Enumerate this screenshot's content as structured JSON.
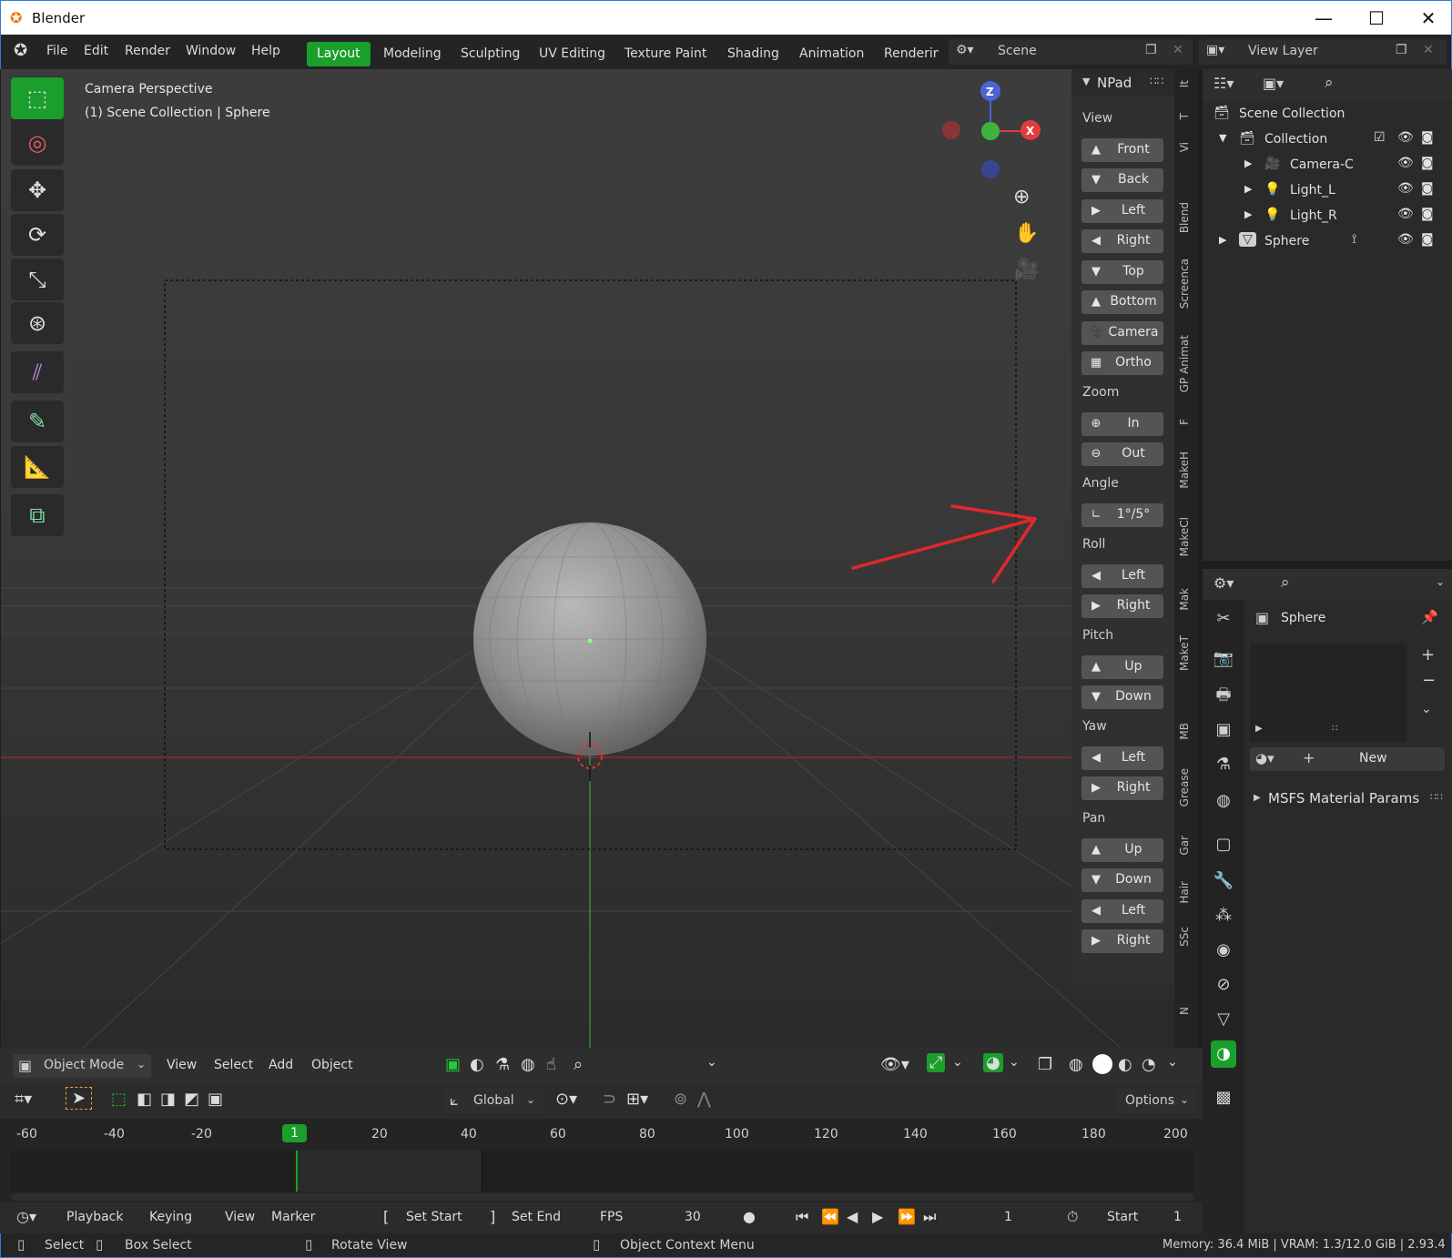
{
  "window": {
    "title": "Blender",
    "minimize": "—",
    "maximize": "☐",
    "close": "✕"
  },
  "menu": {
    "items": [
      "File",
      "Edit",
      "Render",
      "Window",
      "Help"
    ]
  },
  "workspaces": [
    "Layout",
    "Modeling",
    "Sculpting",
    "UV Editing",
    "Texture Paint",
    "Shading",
    "Animation",
    "Renderin"
  ],
  "scene": {
    "label": "Scene"
  },
  "viewlayer": {
    "label": "View Layer"
  },
  "viewport": {
    "perspective": "Camera Perspective",
    "collection": "(1) Scene Collection | Sphere"
  },
  "gizmo": {
    "z": "Z",
    "x": "X"
  },
  "npad": {
    "title": "NPad",
    "sections": {
      "view": "View",
      "zoom": "Zoom",
      "angle": "Angle",
      "roll": "Roll",
      "pitch": "Pitch",
      "yaw": "Yaw",
      "pan": "Pan"
    },
    "view_buttons": [
      "Front",
      "Back",
      "Left",
      "Right",
      "Top",
      "Bottom",
      "Camera",
      "Ortho"
    ],
    "zoom_buttons": [
      "In",
      "Out"
    ],
    "angle_value": "1°/5°",
    "roll_buttons": [
      "Left",
      "Right"
    ],
    "pitch_buttons": [
      "Up",
      "Down"
    ],
    "yaw_buttons": [
      "Left",
      "Right"
    ],
    "pan_buttons": [
      "Up",
      "Down",
      "Left",
      "Right"
    ]
  },
  "sidetabs": [
    "It",
    "T",
    "Vi",
    "Blend",
    "Screenca",
    "GP Animat",
    "F",
    "MakeH",
    "MakeCl",
    "Mak",
    "MakeT",
    "MB",
    "Grease",
    "Gar",
    "Hair",
    "SSc",
    "N"
  ],
  "outliner": {
    "rows": [
      {
        "label": "Scene Collection"
      },
      {
        "label": "Collection"
      },
      {
        "label": "Camera-C"
      },
      {
        "label": "Light_L"
      },
      {
        "label": "Light_R"
      },
      {
        "label": "Sphere"
      }
    ]
  },
  "properties": {
    "object": "Sphere",
    "new_label": "New",
    "panel": "MSFS Material Params"
  },
  "header": {
    "mode": "Object Mode",
    "items": [
      "View",
      "Select",
      "Add",
      "Object"
    ],
    "transform": "Global",
    "options": "Options"
  },
  "timeline": {
    "ticks": [
      "-60",
      "-40",
      "-20",
      "1",
      "20",
      "40",
      "60",
      "80",
      "100",
      "120",
      "140",
      "160",
      "180",
      "200"
    ]
  },
  "playback": {
    "items": [
      "Playback",
      "Keying",
      "View",
      "Marker"
    ],
    "set_start": "Set Start",
    "set_end": "Set End",
    "fps_label": "FPS",
    "fps": "30",
    "frame": "1",
    "start_label": "Start",
    "start": "1"
  },
  "status": {
    "select": "Select",
    "box_select": "Box Select",
    "rotate": "Rotate View",
    "context": "Object Context Menu",
    "memory": "Memory: 36.4 MiB | VRAM: 1.3/12.0 GiB | 2.93.4"
  },
  "colors": {
    "accent": "#1a9e2c",
    "arrow": "#e0282a",
    "axis_x": "#e03c3c",
    "axis_y": "#3fb33f",
    "axis_z": "#4f63d6"
  }
}
